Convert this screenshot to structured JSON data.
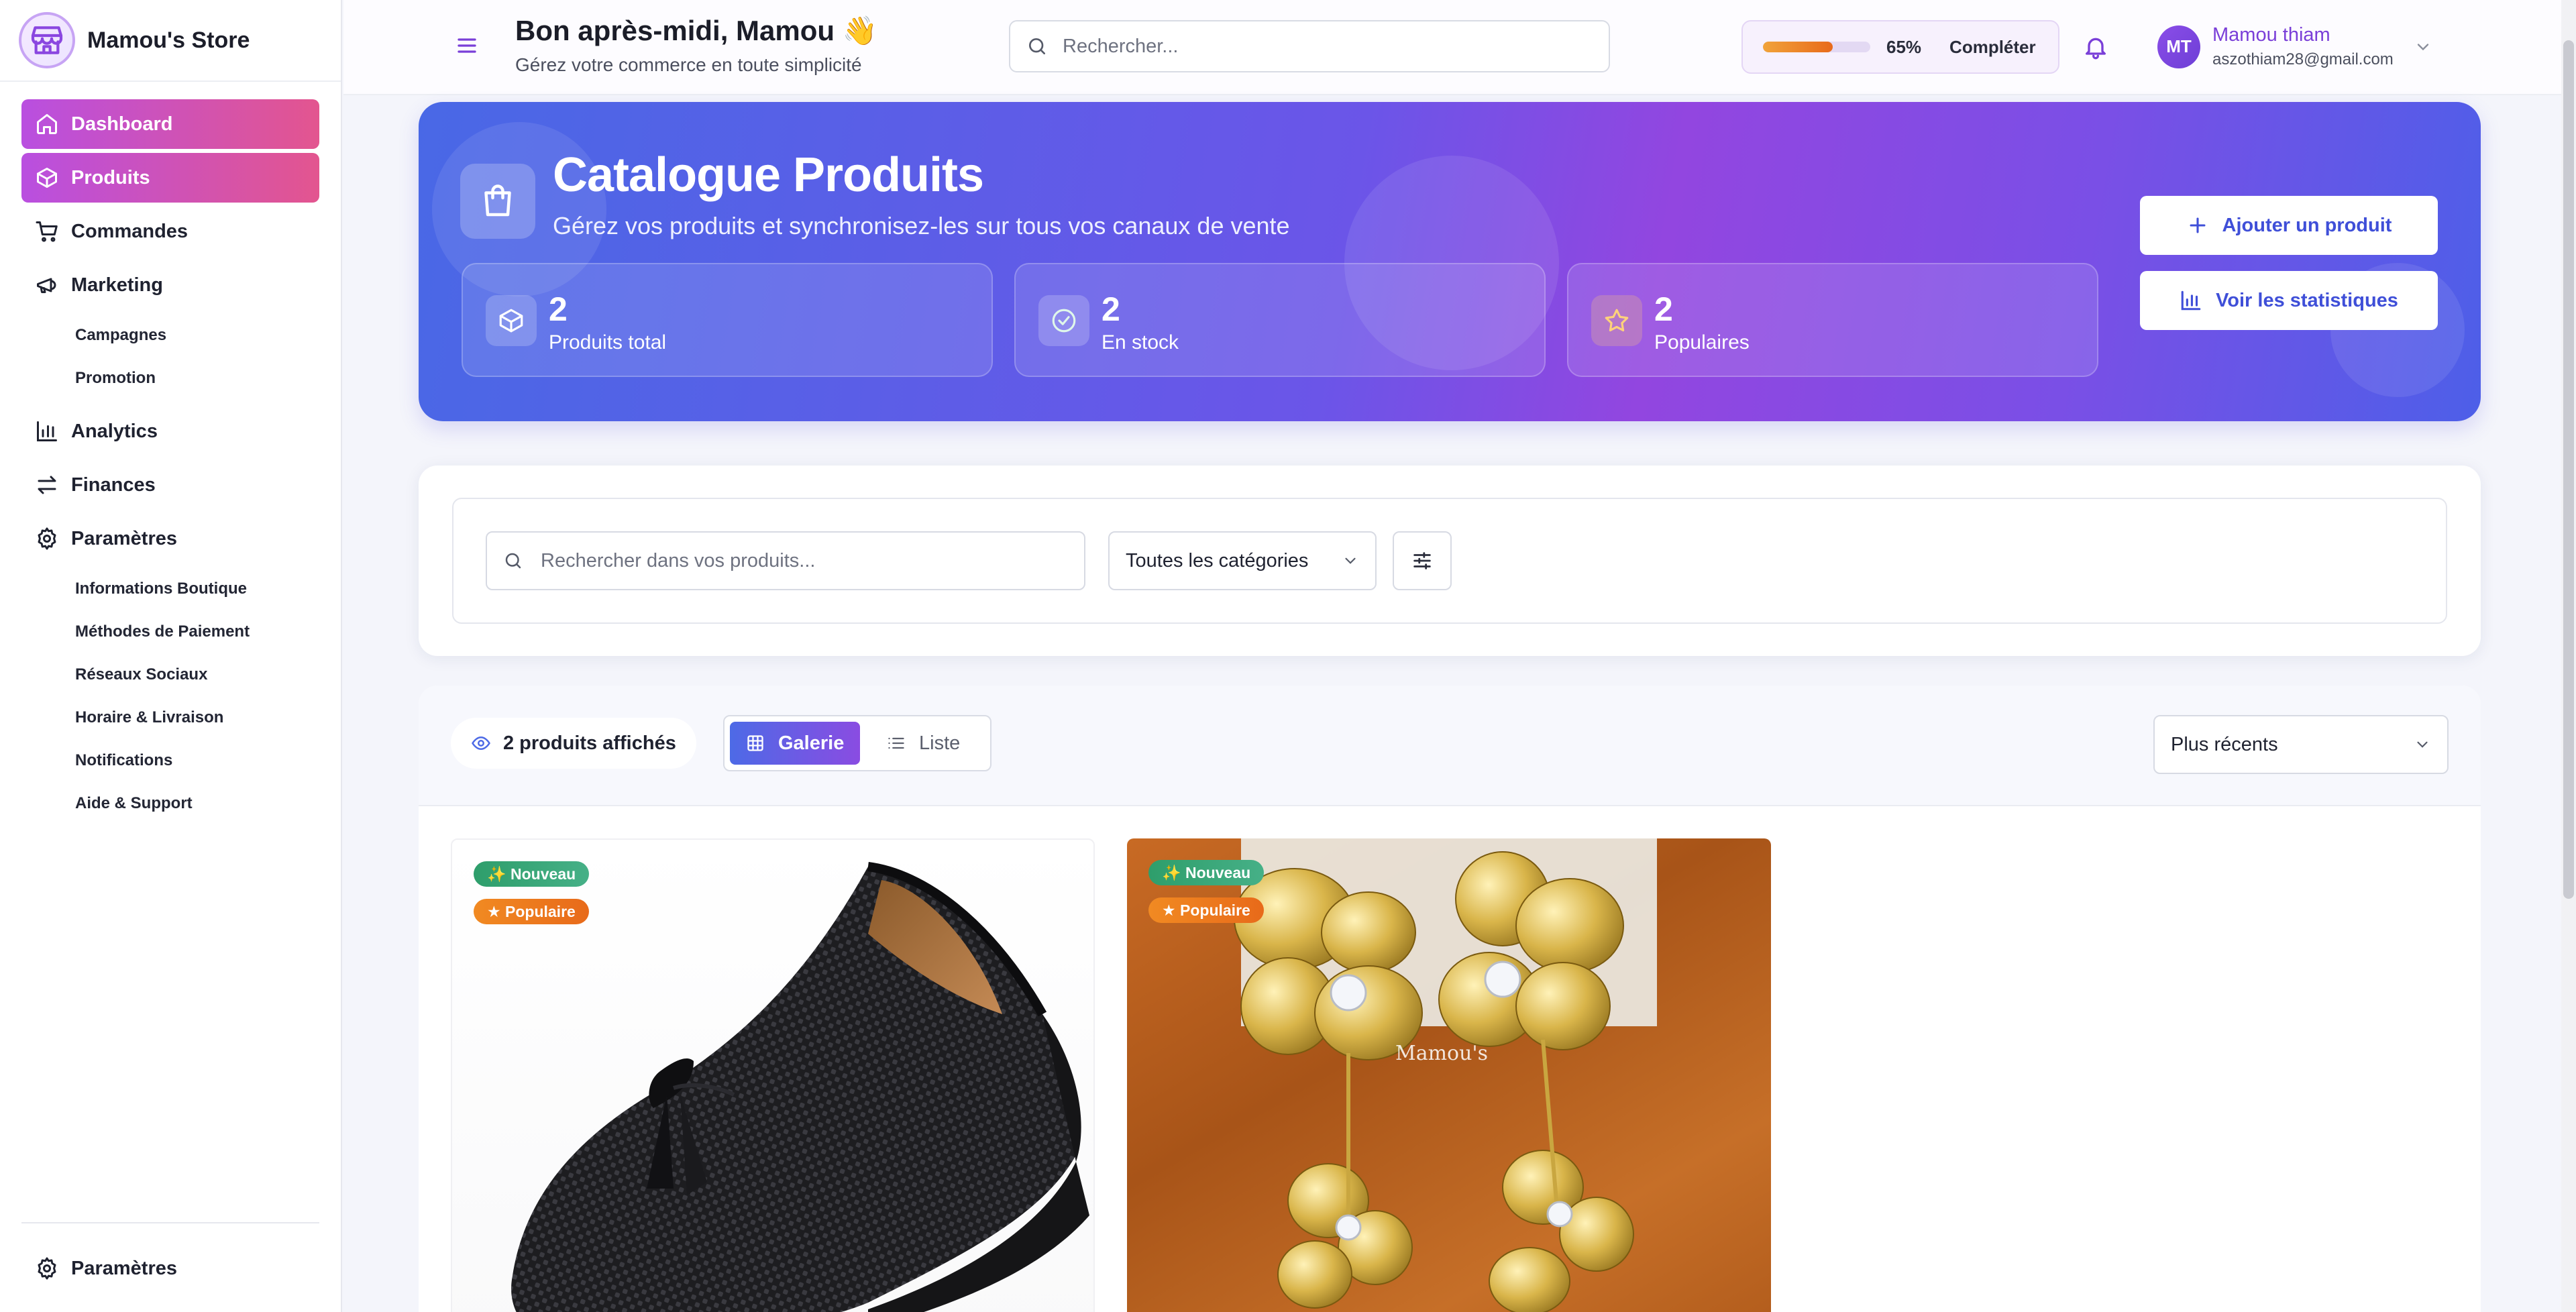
{
  "brand": {
    "name": "Mamou's Store"
  },
  "sidebar": {
    "items": [
      {
        "label": "Dashboard",
        "icon": "home-icon",
        "active": true
      },
      {
        "label": "Produits",
        "icon": "box-icon",
        "active": true
      },
      {
        "label": "Commandes",
        "icon": "cart-icon",
        "active": false
      },
      {
        "label": "Marketing",
        "icon": "megaphone-icon",
        "active": false
      },
      {
        "label": "Analytics",
        "icon": "bar-chart-icon",
        "active": false
      },
      {
        "label": "Finances",
        "icon": "transfer-icon",
        "active": false
      },
      {
        "label": "Paramètres",
        "icon": "gear-icon",
        "active": false
      }
    ],
    "marketing_sub": [
      "Campagnes",
      "Promotion"
    ],
    "settings_sub": [
      "Informations Boutique",
      "Méthodes de Paiement",
      "Réseaux Sociaux",
      "Horaire & Livraison",
      "Notifications",
      "Aide & Support"
    ],
    "bottom_label": "Paramètres"
  },
  "header": {
    "greeting": "Bon après-midi, Mamou 👋",
    "subtitle": "Gérez votre commerce en toute simplicité",
    "search_placeholder": "Rechercher...",
    "progress": {
      "percent": 65,
      "label": "65%",
      "button": "Compléter"
    },
    "user": {
      "initials": "MT",
      "name": "Mamou thiam",
      "email": "aszothiam28@gmail.com"
    }
  },
  "hero": {
    "title": "Catalogue Produits",
    "subtitle": "Gérez vos produits et synchronisez-les sur tous vos canaux de vente",
    "stats": [
      {
        "value": "2",
        "label": "Produits total",
        "icon": "box-icon"
      },
      {
        "value": "2",
        "label": "En stock",
        "icon": "check-circle-icon"
      },
      {
        "value": "2",
        "label": "Populaires",
        "icon": "star-icon"
      }
    ],
    "add_button": "Ajouter un produit",
    "stats_button": "Voir les statistiques"
  },
  "filters": {
    "search_placeholder": "Rechercher dans vos produits...",
    "category": "Toutes les catégories"
  },
  "products": {
    "count_label": "2 produits affichés",
    "view_gallery": "Galerie",
    "view_list": "Liste",
    "sort": "Plus récents",
    "badges": {
      "new": "✨ Nouveau",
      "popular": "Populaire"
    },
    "watermark": "Mamou's"
  },
  "colors": {
    "accent": "#7a3fd8",
    "active_nav_start": "#b94fe0",
    "active_nav_end": "#e3558f",
    "hero_start": "#4968e6",
    "hero_end": "#9246e0"
  }
}
